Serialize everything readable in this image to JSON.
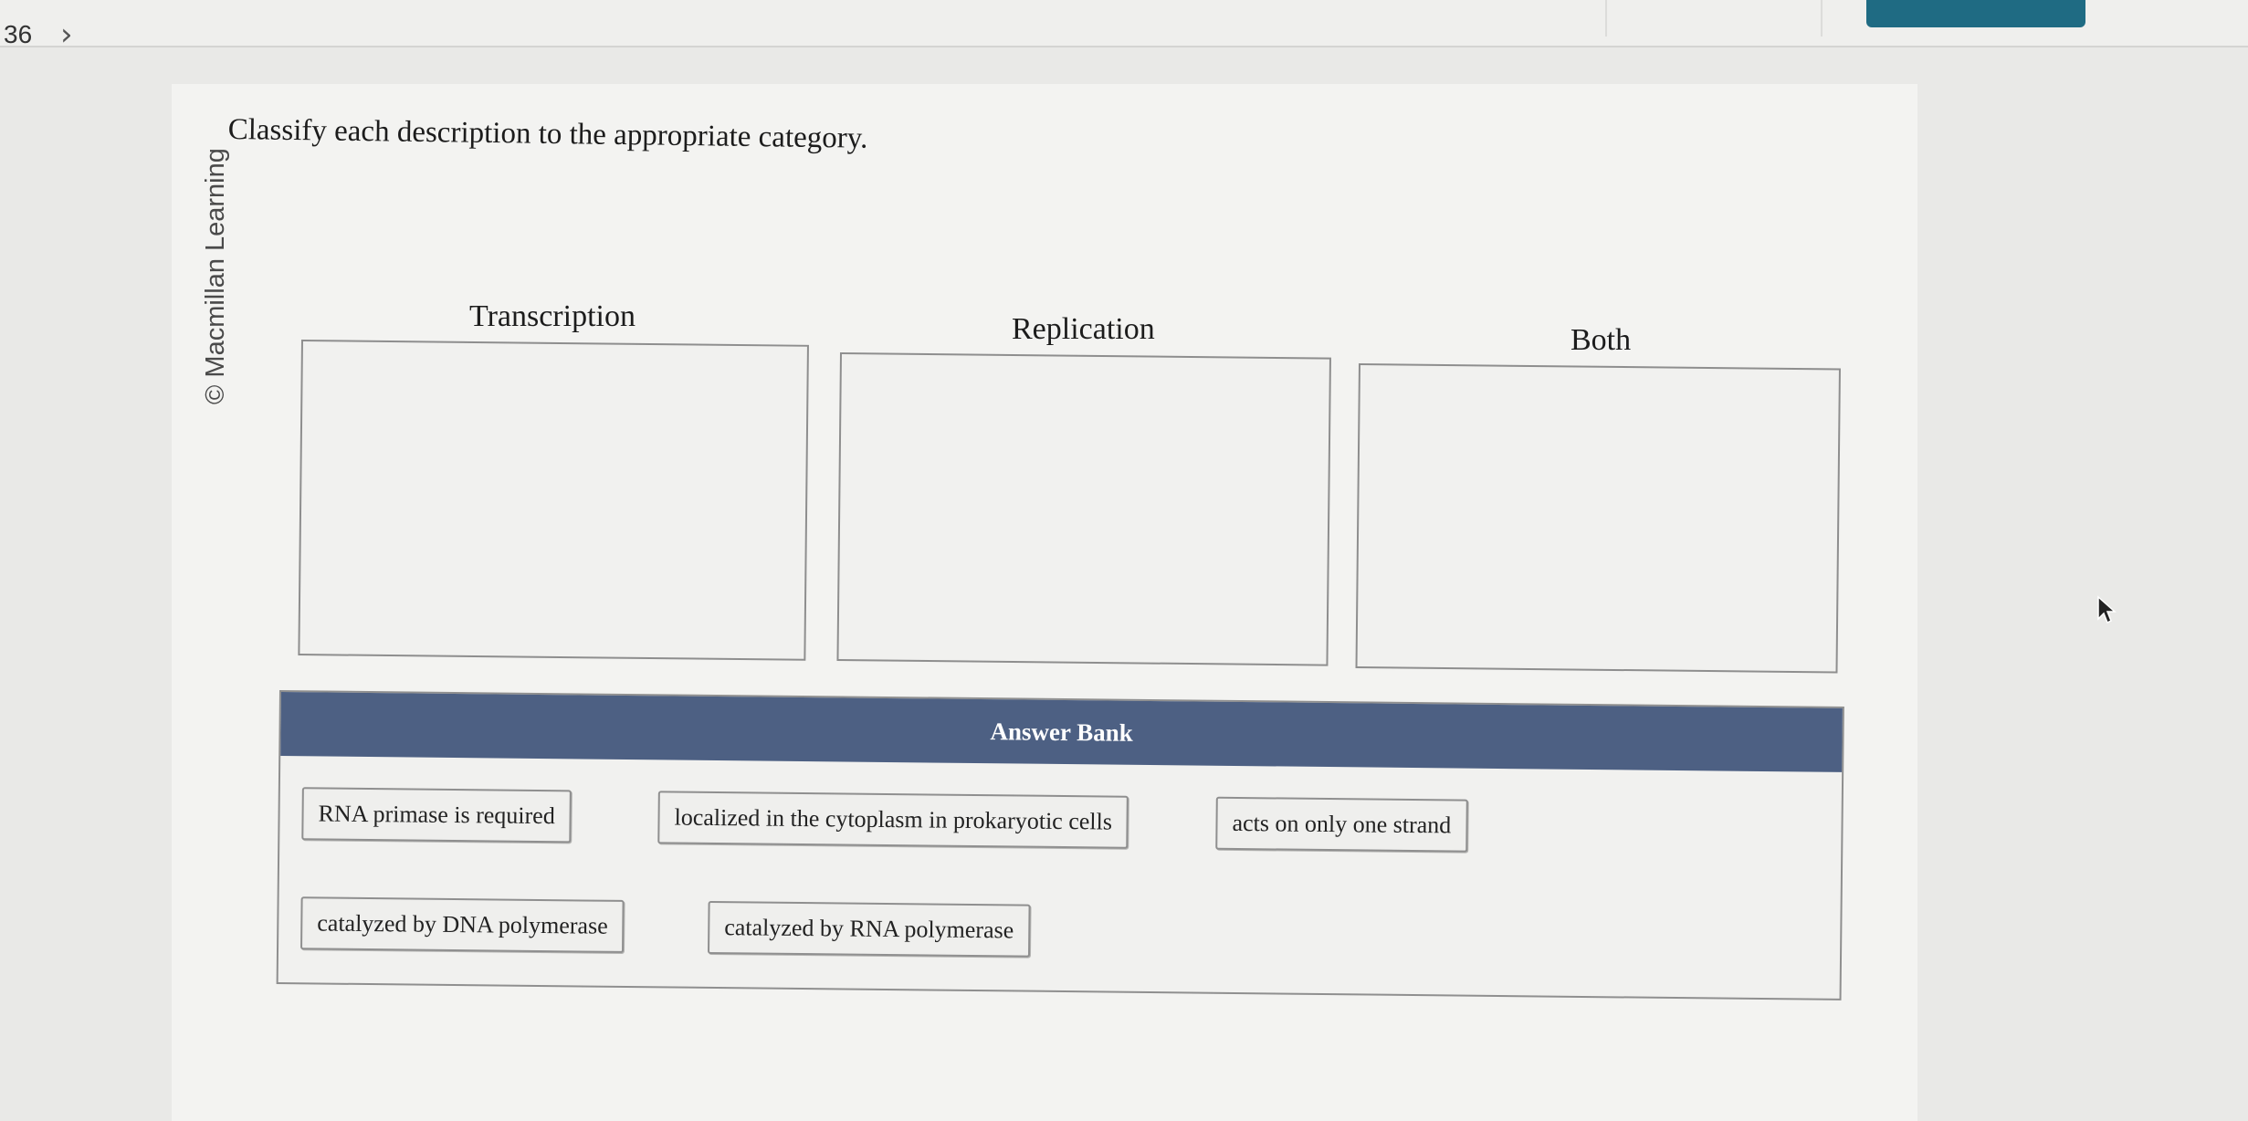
{
  "header": {
    "question_number": "36",
    "next_glyph": "›"
  },
  "sidebar": {
    "copyright": "© Macmillan Learning"
  },
  "question": {
    "instruction": "Classify each description to the appropriate category."
  },
  "bins": [
    {
      "label": "Transcription"
    },
    {
      "label": "Replication"
    },
    {
      "label": "Both"
    }
  ],
  "answer_bank": {
    "title": "Answer Bank",
    "items": [
      "RNA primase is required",
      "localized in the cytoplasm in prokaryotic cells",
      "acts on only one strand",
      "catalyzed by DNA polymerase",
      "catalyzed by RNA polymerase"
    ]
  },
  "colors": {
    "bank_header": "#4d6083",
    "submit_button": "#1f6b83",
    "background": "#e9e9e7"
  }
}
